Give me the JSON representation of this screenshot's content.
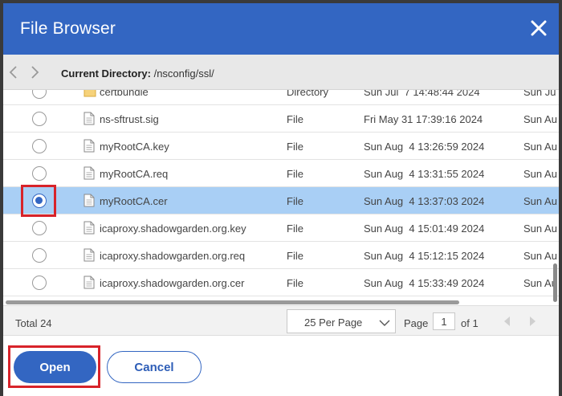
{
  "dialog": {
    "title": "File Browser",
    "current_directory_label": "Current Directory:",
    "current_directory": "/nsconfig/ssl/"
  },
  "files": [
    {
      "name": "certbundle",
      "type": "Directory",
      "date": "Sun Jul  7 14:48:44 2024",
      "modified": "Sun Ju",
      "icon": "folder-icon",
      "selected": false
    },
    {
      "name": "ns-sftrust.sig",
      "type": "File",
      "date": "Fri May 31 17:39:16 2024",
      "modified": "Sun Au",
      "icon": "file-icon",
      "selected": false
    },
    {
      "name": "myRootCA.key",
      "type": "File",
      "date": "Sun Aug  4 13:26:59 2024",
      "modified": "Sun Au",
      "icon": "file-icon",
      "selected": false
    },
    {
      "name": "myRootCA.req",
      "type": "File",
      "date": "Sun Aug  4 13:31:55 2024",
      "modified": "Sun Au",
      "icon": "file-icon",
      "selected": false
    },
    {
      "name": "myRootCA.cer",
      "type": "File",
      "date": "Sun Aug  4 13:37:03 2024",
      "modified": "Sun Au",
      "icon": "file-icon",
      "selected": true
    },
    {
      "name": "icaproxy.shadowgarden.org.key",
      "type": "File",
      "date": "Sun Aug  4 15:01:49 2024",
      "modified": "Sun Au",
      "icon": "file-icon",
      "selected": false
    },
    {
      "name": "icaproxy.shadowgarden.org.req",
      "type": "File",
      "date": "Sun Aug  4 15:12:15 2024",
      "modified": "Sun Au",
      "icon": "file-icon",
      "selected": false
    },
    {
      "name": "icaproxy.shadowgarden.org.cer",
      "type": "File",
      "date": "Sun Aug  4 15:33:49 2024",
      "modified": "Sun Au",
      "icon": "file-icon",
      "selected": false
    }
  ],
  "pager": {
    "total": "Total  24",
    "per_page": "25 Per Page",
    "page_label": "Page",
    "page_value": "1",
    "of_label": "of 1"
  },
  "buttons": {
    "open": "Open",
    "cancel": "Cancel"
  },
  "colors": {
    "primary": "#3366c2",
    "selected_row": "#a9cff5",
    "highlight": "#d8232a"
  }
}
